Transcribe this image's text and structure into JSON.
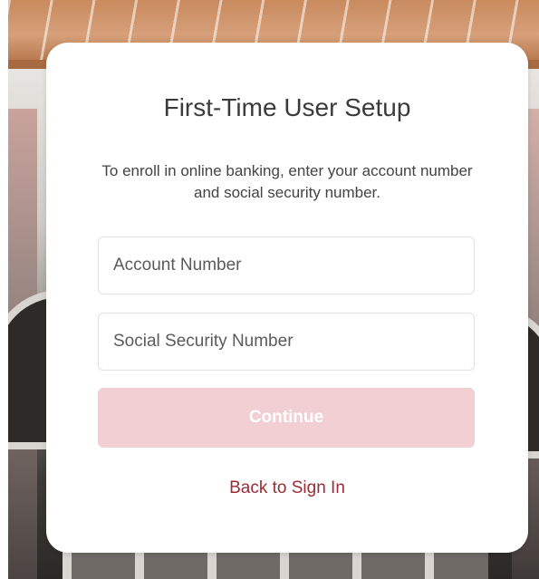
{
  "setup": {
    "title": "First-Time User Setup",
    "instructions": "To enroll in online banking, enter your account number and social security number.",
    "account_number": {
      "placeholder": "Account Number",
      "value": ""
    },
    "ssn": {
      "placeholder": "Social Security Number",
      "value": ""
    },
    "continue_label": "Continue",
    "continue_disabled": true,
    "back_link_label": "Back to Sign In"
  },
  "colors": {
    "card_background": "#ffffff",
    "title_text": "#3b3b3b",
    "button_disabled": "#f2cfd3",
    "link": "#9b2c36"
  }
}
